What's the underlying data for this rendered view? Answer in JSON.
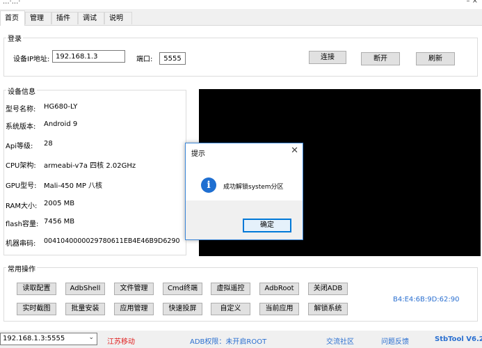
{
  "window": {
    "title": "...·...·",
    "controls": "–  ×"
  },
  "tabs": [
    {
      "label": "首页",
      "active": true
    },
    {
      "label": "管理"
    },
    {
      "label": "插件"
    },
    {
      "label": "调试"
    },
    {
      "label": "说明"
    }
  ],
  "login": {
    "legend": "登录",
    "ip_label": "设备IP地址:",
    "ip_value": "192.168.1.3",
    "port_label": "端口:",
    "port_value": "5555",
    "connect_label": "连接",
    "disconnect_label": "断开",
    "refresh_label": "刷新"
  },
  "device_info": {
    "legend": "设备信息",
    "rows": [
      {
        "label": "型号名称:",
        "value": "HG680-LY"
      },
      {
        "label": "系统版本:",
        "value": "Android 9"
      },
      {
        "label": "Api等级:",
        "value": "28"
      },
      {
        "label": "CPU架构:",
        "value": "armeabi-v7a 四核 2.02GHz"
      },
      {
        "label": "GPU型号:",
        "value": "Mali-450 MP 八核"
      },
      {
        "label": "RAM大小:",
        "value": "2005 MB"
      },
      {
        "label": "flash容量:",
        "value": "7456 MB"
      },
      {
        "label": "机器串码:",
        "value": "0041040000029780611EB4E46B9D6290"
      }
    ]
  },
  "dialog": {
    "title": "提示",
    "close": "✕",
    "icon": "i",
    "message": "成功解锁system分区",
    "ok_label": "确定"
  },
  "ops": {
    "legend": "常用操作",
    "row1": [
      "读取配置",
      "AdbShell",
      "文件管理",
      "Cmd终端",
      "虚拟遥控",
      "AdbRoot",
      "关闭ADB"
    ],
    "row2": [
      "实时截图",
      "批量安装",
      "应用管理",
      "快速投屏",
      "自定义",
      "当前应用",
      "解锁系统"
    ],
    "mac": "B4:E4:6B:9D:62:90"
  },
  "status": {
    "device_select": "192.168.1.3:5555",
    "dropdown_arrow": "⌄",
    "isp": "江苏移动",
    "adb_perm": "ADB权限：未开启ROOT",
    "community": "交流社区",
    "feedback": "问题反馈",
    "version": "StbTool V6.2"
  },
  "colors": {
    "isp": "#e02020",
    "link": "#2a6fd0",
    "version": "#2a6fd0",
    "mac": "#2a6fd0"
  }
}
